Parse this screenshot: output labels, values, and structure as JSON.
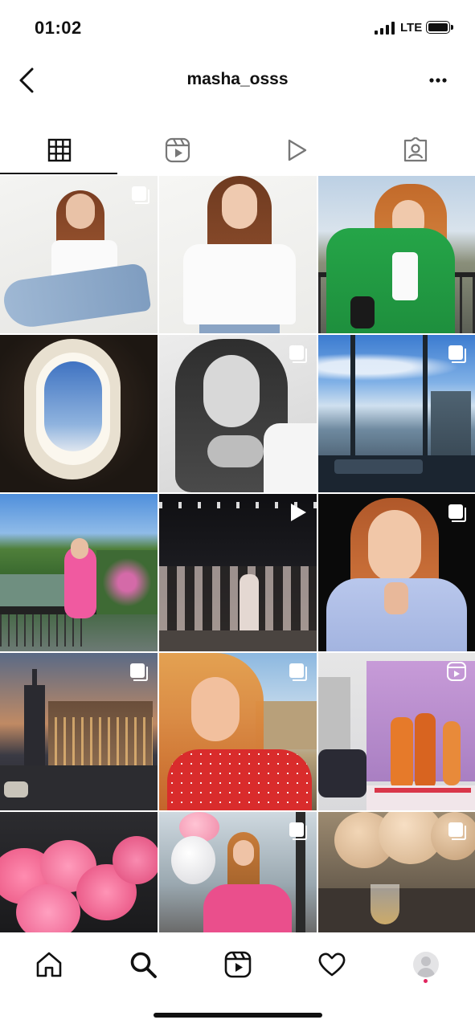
{
  "status_bar": {
    "time": "01:02",
    "network": "LTE"
  },
  "header": {
    "username": "masha_osss"
  },
  "profile_tabs": [
    {
      "name": "posts-grid",
      "icon": "grid-icon",
      "active": true
    },
    {
      "name": "reels",
      "icon": "reels-icon",
      "active": false
    },
    {
      "name": "videos",
      "icon": "play-icon",
      "active": false
    },
    {
      "name": "tagged",
      "icon": "tagged-person-icon",
      "active": false
    }
  ],
  "posts": [
    {
      "subject": "model in white tee and jeans sitting",
      "badge": "carousel-icon"
    },
    {
      "subject": "model smiling in white tee",
      "badge": "none"
    },
    {
      "subject": "woman in green blazer on balcony",
      "badge": "none"
    },
    {
      "subject": "airplane window view",
      "badge": "none"
    },
    {
      "subject": "black and white portrait",
      "badge": "carousel-icon"
    },
    {
      "subject": "city skyscraper view from restaurant",
      "badge": "carousel-icon"
    },
    {
      "subject": "woman in pink dress by river",
      "badge": "none"
    },
    {
      "subject": "fashion runway show",
      "badge": "video-icon"
    },
    {
      "subject": "woman in lilac blazer",
      "badge": "carousel-icon"
    },
    {
      "subject": "city street at sunset",
      "badge": "carousel-icon"
    },
    {
      "subject": "woman with windblown hair in red dress",
      "badge": "carousel-icon"
    },
    {
      "subject": "runway models in orange",
      "badge": "reels-icon"
    },
    {
      "subject": "pink roses bouquet",
      "badge": "none"
    },
    {
      "subject": "woman in pink with balloons",
      "badge": "carousel-icon"
    },
    {
      "subject": "balloons and wine glass",
      "badge": "carousel-icon"
    }
  ],
  "bottom_nav": [
    {
      "name": "home",
      "icon": "home-icon"
    },
    {
      "name": "search",
      "icon": "search-icon"
    },
    {
      "name": "reels",
      "icon": "reels-icon"
    },
    {
      "name": "activity",
      "icon": "heart-icon"
    },
    {
      "name": "profile",
      "icon": "avatar"
    }
  ],
  "colors": {
    "accent_dot": "#e0245e",
    "text": "#111111",
    "divider": "#dbdbdb"
  }
}
